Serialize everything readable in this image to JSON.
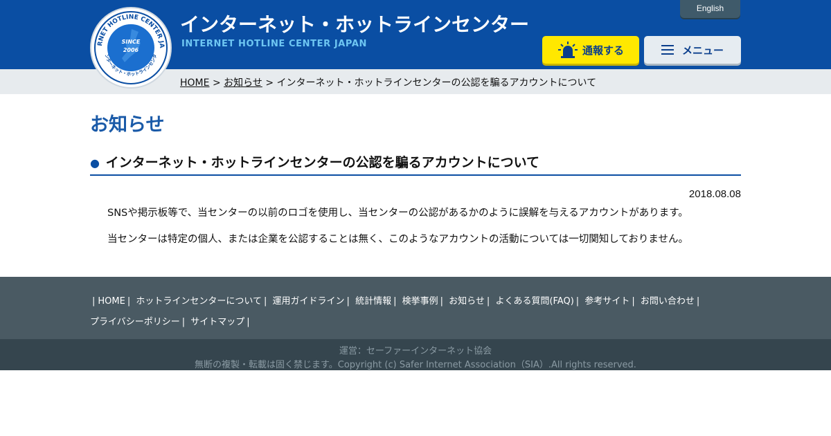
{
  "header": {
    "logo": {
      "ring_text": "INTERNET HOTLINE CENTER JAPAN",
      "since_label": "SINCE",
      "since_year": "2006",
      "bottom_text": "インターネット・ホットラインセンター"
    },
    "title_ja": "インターネット・ホットラインセンター",
    "title_en": "INTERNET HOTLINE CENTER JAPAN",
    "lang_label": "English",
    "report_label": "通報する",
    "menu_label": "メニュー"
  },
  "breadcrumb": {
    "home": "HOME",
    "sep1": ">",
    "news": "お知らせ",
    "sep2": ">",
    "current": "インターネット・ホットラインセンターの公認を騙るアカウントについて"
  },
  "main": {
    "heading": "お知らせ",
    "article_bullet": "●",
    "article_title": "インターネット・ホットラインセンターの公認を騙るアカウントについて",
    "date": "2018.08.08",
    "paragraphs": [
      "SNSや掲示板等で、当センターの以前のロゴを使用し、当センターの公認があるかのように誤解を与えるアカウントがあります。",
      "当センターは特定の個人、または企業を公認することは無く、このようなアカウントの活動については一切関知しておりません。"
    ]
  },
  "footer": {
    "lead_sep": "|",
    "links": [
      "HOME",
      "ホットラインセンターについて",
      "運用ガイドライン",
      "統計情報",
      "検挙事例",
      "お知らせ",
      "よくある質問(FAQ)",
      "参考サイト",
      "お問い合わせ",
      "プライバシーポリシー",
      "サイトマップ"
    ],
    "sep": "|",
    "operator": "運営：セーファーインターネット協会",
    "copyright": "無断の複製・転載は固く禁じます。Copyright (c) Safer Internet Association（SIA）.All rights reserved."
  },
  "colors": {
    "header_blue": "#0a4ea3",
    "report_yellow": "#ffe800",
    "footer_gray": "#4a5a63",
    "copy_gray": "#35454e"
  }
}
